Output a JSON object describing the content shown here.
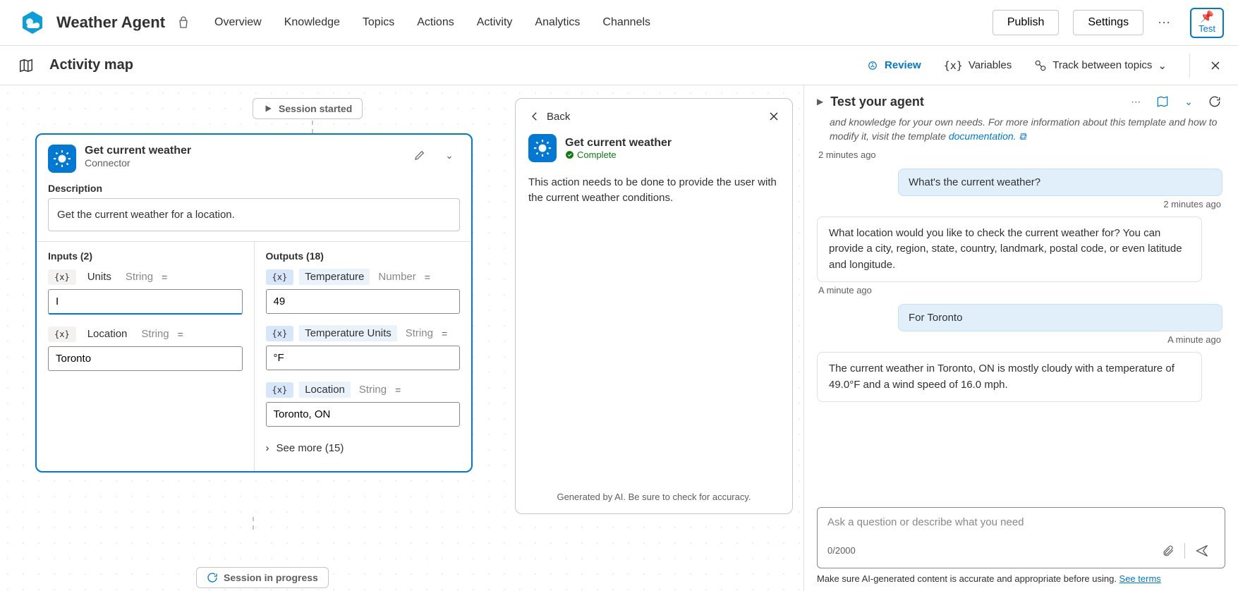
{
  "header": {
    "agent_name": "Weather Agent",
    "nav": {
      "overview": "Overview",
      "knowledge": "Knowledge",
      "topics": "Topics",
      "actions": "Actions",
      "activity": "Activity",
      "analytics": "Analytics",
      "channels": "Channels"
    },
    "publish": "Publish",
    "settings": "Settings",
    "test": "Test"
  },
  "subheader": {
    "title": "Activity map",
    "review": "Review",
    "variables": "Variables",
    "track": "Track between topics"
  },
  "canvas": {
    "session_started": "Session started",
    "session_progress": "Session in progress",
    "node": {
      "title": "Get current weather",
      "subtitle": "Connector",
      "desc_label": "Description",
      "desc_value": "Get the current weather for a location.",
      "inputs_header": "Inputs (2)",
      "outputs_header": "Outputs (18)",
      "inputs": [
        {
          "name": "Units",
          "type": "String",
          "value": "I"
        },
        {
          "name": "Location",
          "type": "String",
          "value": "Toronto"
        }
      ],
      "outputs": [
        {
          "name": "Temperature",
          "type": "Number",
          "value": "49"
        },
        {
          "name": "Temperature Units",
          "type": "String",
          "value": "°F"
        },
        {
          "name": "Location",
          "type": "String",
          "value": "Toronto, ON"
        }
      ],
      "see_more": "See more (15)"
    }
  },
  "detail": {
    "back": "Back",
    "title": "Get current weather",
    "status": "Complete",
    "body": "This action needs to be done to provide the user with the current weather conditions.",
    "footer": "Generated by AI. Be sure to check for accuracy."
  },
  "test": {
    "title": "Test your agent",
    "intro_prefix": "and knowledge for your own needs. For more information about this template and how to modify it, visit the template ",
    "intro_link": "documentation.",
    "ts1": "2 minutes ago",
    "user1": "What's the current weather?",
    "ts2": "2 minutes ago",
    "bot1": "What location would you like to check the current weather for? You can provide a city, region, state, country, landmark, postal code, or even latitude and longitude.",
    "ts3": "A minute ago",
    "user2": "For Toronto",
    "ts4": "A minute ago",
    "bot2": "The current weather in Toronto, ON is mostly cloudy with a temperature of 49.0°F and a wind speed of 16.0 mph.",
    "input_placeholder": "Ask a question or describe what you need",
    "counter": "0/2000",
    "disclaimer": "Make sure AI-generated content is accurate and appropriate before using. ",
    "terms": "See terms"
  },
  "icons": {
    "vx": "{x}"
  }
}
